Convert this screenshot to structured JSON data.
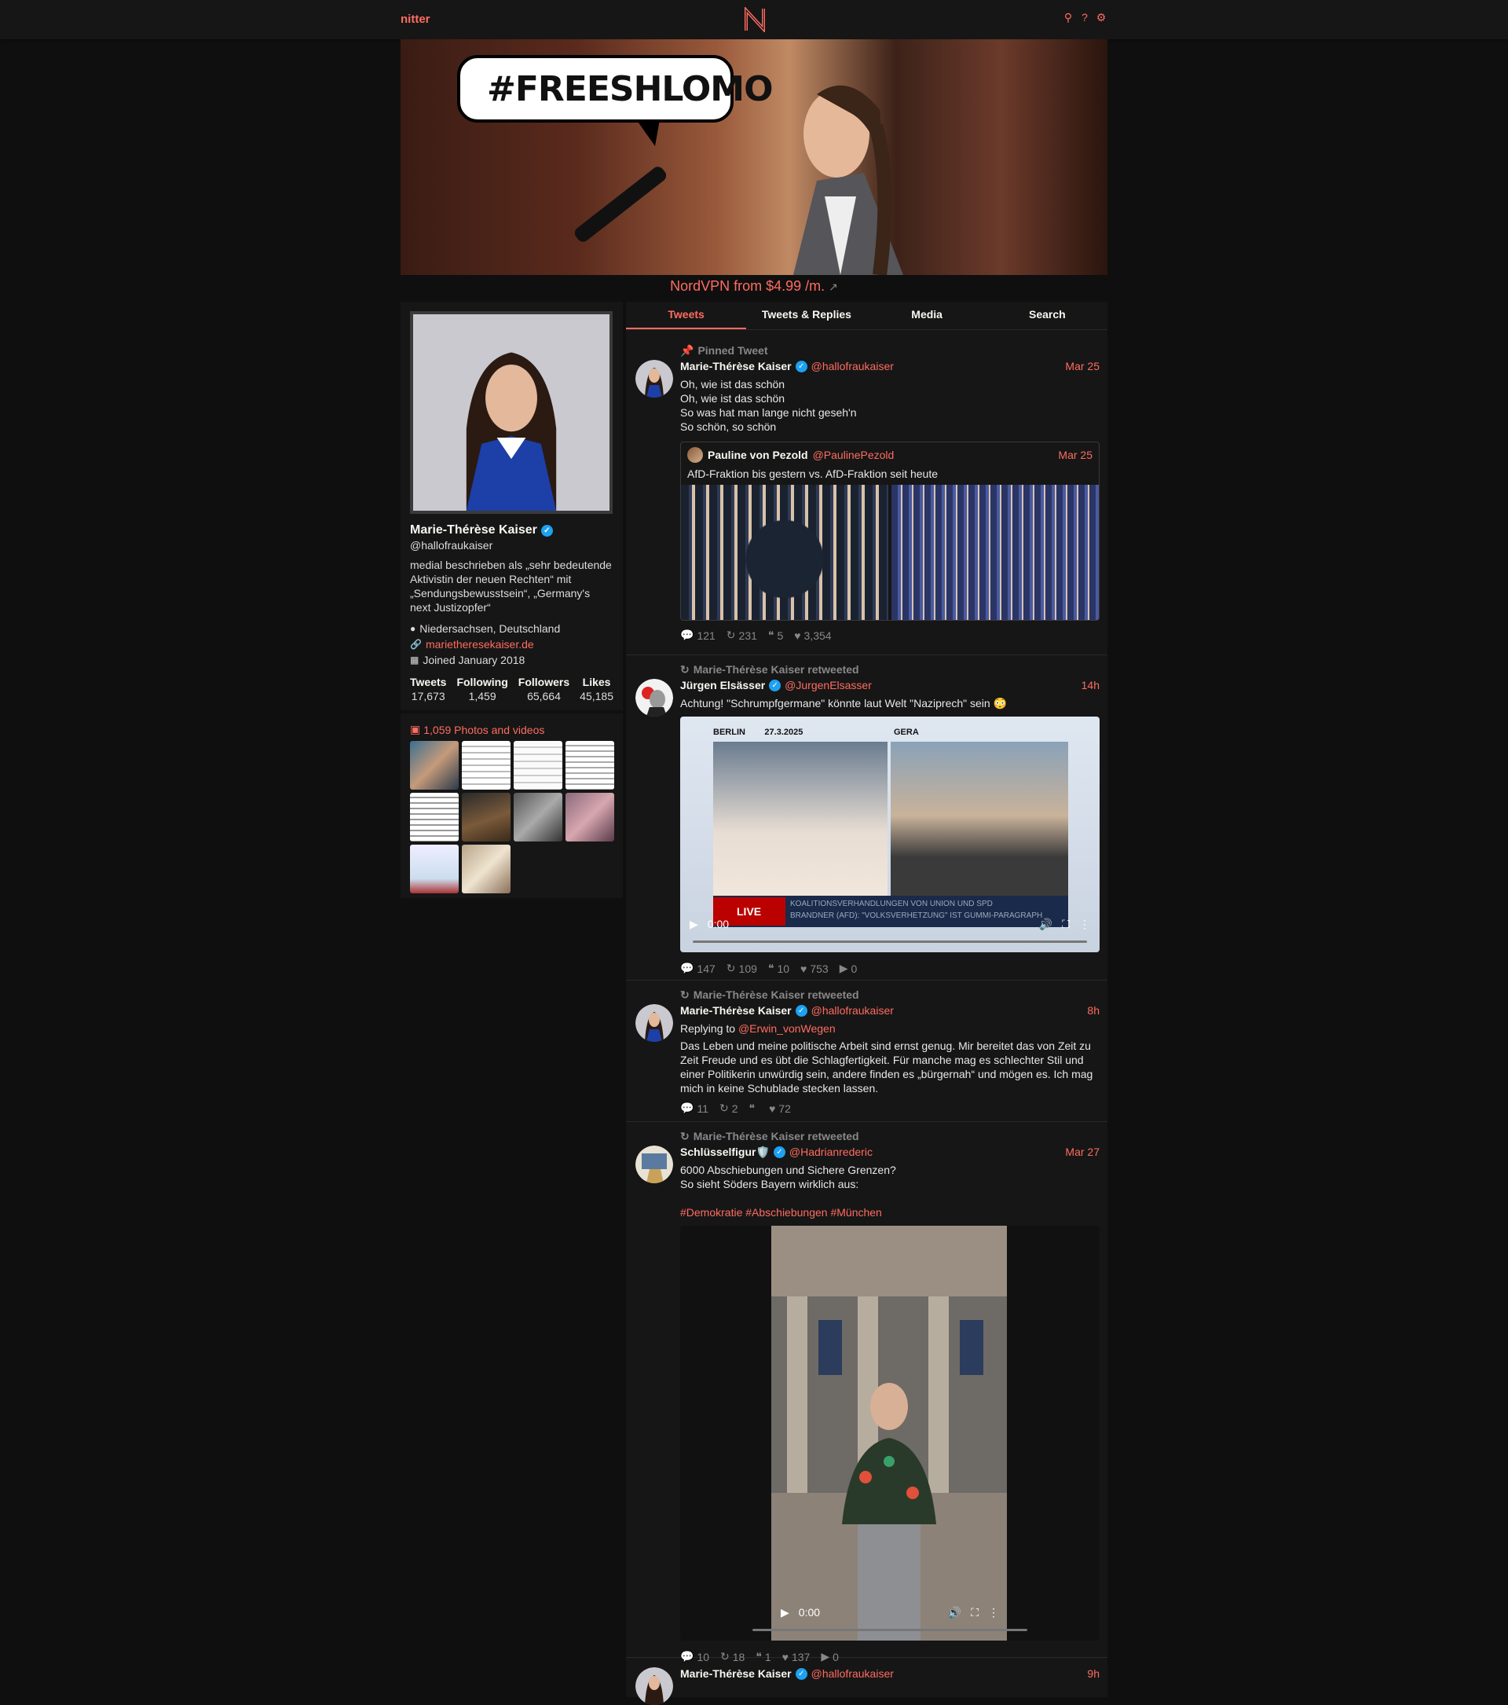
{
  "nav": {
    "brand": "nitter"
  },
  "banner": {
    "speech_text": "#FREESHLOMO"
  },
  "sponsor": {
    "text": "NordVPN from $4.99 /m."
  },
  "profile": {
    "fullname": "Marie-Thérèse Kaiser",
    "username": "@hallofraukaiser",
    "bio": "medial beschrieben als „sehr bedeutende Aktivistin der neuen Rechten“ mit „Sendungsbewusstsein“, „Germany's next Justizopfer“",
    "location": "Niedersachsen, Deutschland",
    "website": "marietheresekaiser.de",
    "joined": "Joined January 2018",
    "stats": [
      {
        "label": "Tweets",
        "value": "17,673"
      },
      {
        "label": "Following",
        "value": "1,459"
      },
      {
        "label": "Followers",
        "value": "65,664"
      },
      {
        "label": "Likes",
        "value": "45,185"
      }
    ]
  },
  "photos": {
    "title": "1,059 Photos and videos"
  },
  "tabs": [
    "Tweets",
    "Tweets & Replies",
    "Media",
    "Search"
  ],
  "tweets": [
    {
      "header": "Pinned Tweet",
      "fullname": "Marie-Thérèse Kaiser",
      "username": "@hallofraukaiser",
      "date": "Mar 25",
      "lines": [
        "Oh, wie ist das schön",
        "Oh, wie ist das schön",
        "So was hat man lange nicht geseh'n",
        "So schön, so schön"
      ],
      "quote": {
        "fullname": "Pauline von Pezold",
        "username": "@PaulinePezold",
        "date": "Mar 25",
        "text": "AfD-Fraktion bis gestern vs. AfD-Fraktion seit heute"
      },
      "stats": {
        "replies": "121",
        "retweets": "231",
        "quotes": "5",
        "likes": "3,354"
      }
    },
    {
      "header": "Marie-Thérèse Kaiser retweeted",
      "fullname": "Jürgen Elsässer",
      "username": "@JurgenElsasser",
      "date": "14h",
      "text": "Achtung! \"Schrumpfgermane\" könnte laut Welt \"Naziprech\" sein 😳",
      "video": {
        "time": "0:00",
        "label_left": "BERLIN",
        "date_left": "27.3.2025",
        "label_right": "GERA",
        "live": "LIVE",
        "ticker1": "KOALITIONSVERHANDLUNGEN VON UNION UND SPD",
        "ticker2": "BRANDNER (AFD): \"VOLKSVERHETZUNG\" IST GUMMI-PARAGRAPH"
      },
      "stats": {
        "replies": "147",
        "retweets": "109",
        "quotes": "10",
        "likes": "753",
        "views": "0"
      }
    },
    {
      "header": "Marie-Thérèse Kaiser retweeted",
      "fullname": "Marie-Thérèse Kaiser",
      "username": "@hallofraukaiser",
      "date": "8h",
      "replying_label": "Replying to",
      "replying_to": "@Erwin_vonWegen",
      "text": "Das Leben und meine politische Arbeit sind ernst genug. Mir bereitet das von Zeit zu Zeit Freude und es übt die Schlagfertigkeit. Für manche mag es schlechter Stil und einer Politikerin unwürdig sein, andere finden es „bürgernah“ und mögen es. Ich mag mich in keine Schublade stecken lassen.",
      "stats": {
        "replies": "11",
        "retweets": "2",
        "quotes": "",
        "likes": "72"
      }
    },
    {
      "header": "Marie-Thérèse Kaiser retweeted",
      "fullname": "Schlüsselfigur🛡️",
      "username": "@Hadrianrederic",
      "date": "Mar 27",
      "lines": [
        "6000 Abschiebungen und Sichere Grenzen?",
        "So sieht Söders Bayern wirklich aus:"
      ],
      "hashtags": "#Demokratie #Abschiebungen #München",
      "video": {
        "time": "0:00"
      },
      "stats": {
        "replies": "10",
        "retweets": "18",
        "quotes": "1",
        "likes": "137",
        "views": "0"
      }
    },
    {
      "fullname": "Marie-Thérèse Kaiser",
      "username": "@hallofraukaiser",
      "date": "9h"
    }
  ]
}
